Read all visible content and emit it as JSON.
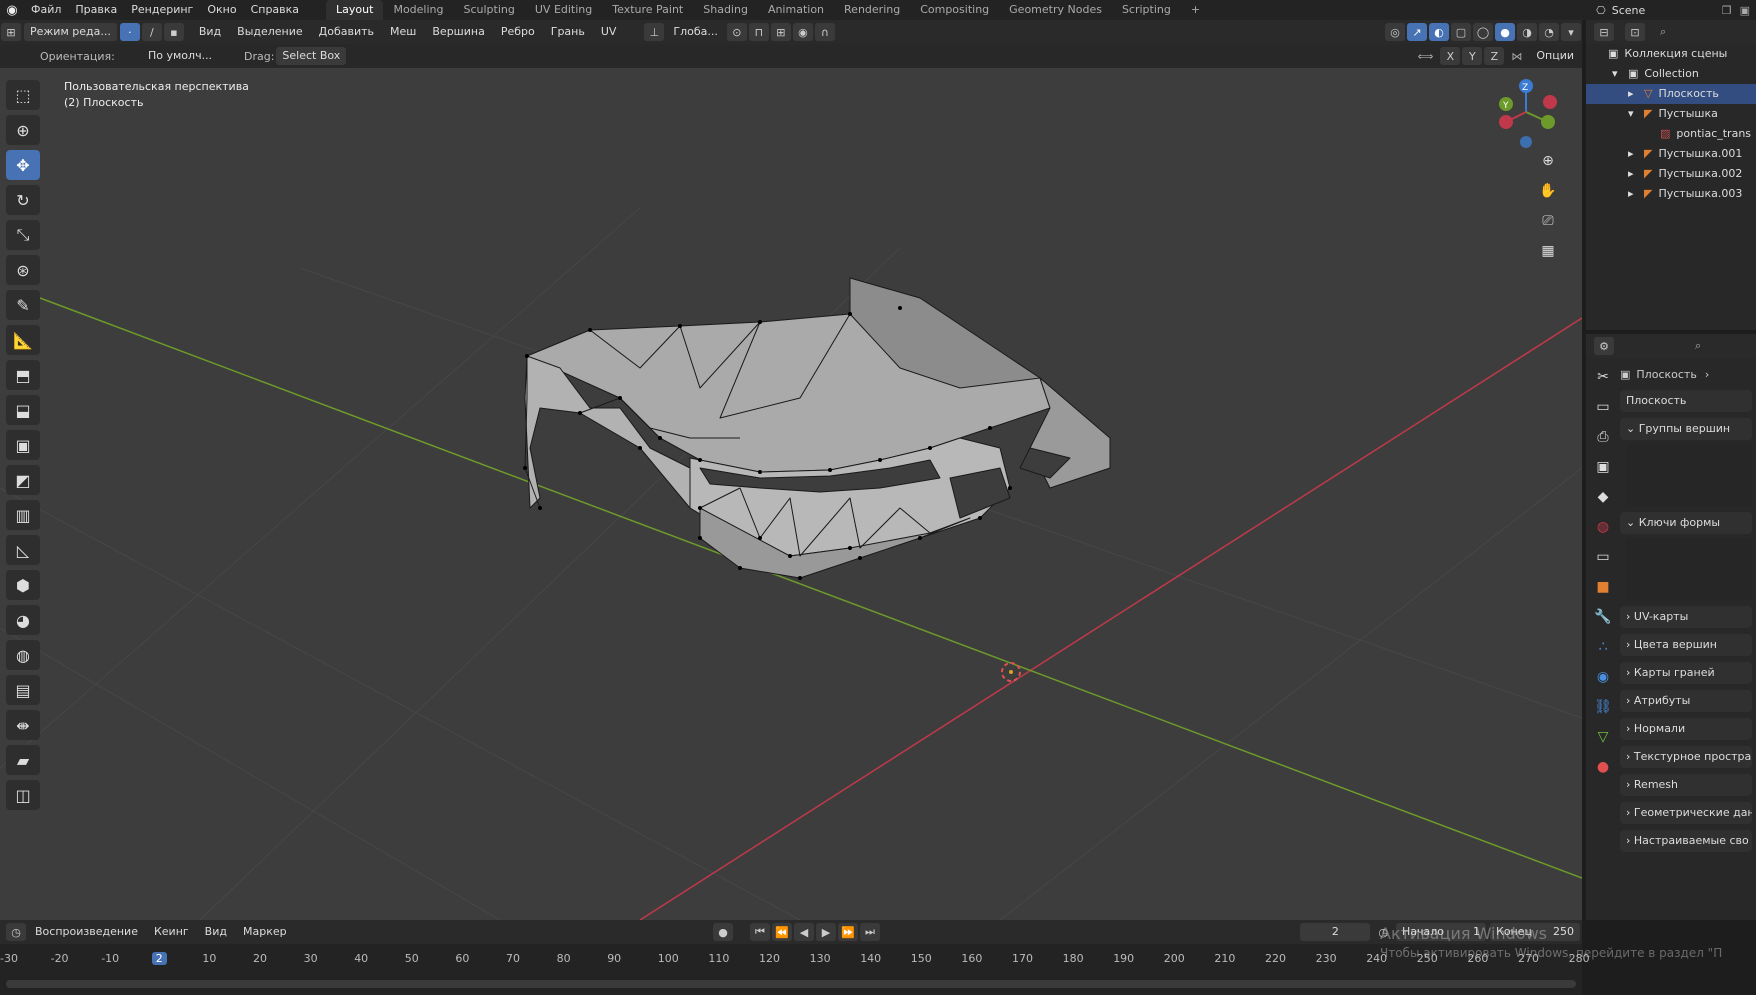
{
  "app_logo": "blender-icon",
  "menus": [
    "Файл",
    "Правка",
    "Рендеринг",
    "Окно",
    "Справка"
  ],
  "workspace_tabs": [
    "Layout",
    "Modeling",
    "Sculpting",
    "UV Editing",
    "Texture Paint",
    "Shading",
    "Animation",
    "Rendering",
    "Compositing",
    "Geometry Nodes",
    "Scripting",
    "+"
  ],
  "active_tab": "Layout",
  "scene_name": "Scene",
  "header3d": {
    "mode": "Режим реда...",
    "menus": [
      "Вид",
      "Выделение",
      "Добавить",
      "Меш",
      "Вершина",
      "Ребро",
      "Грань",
      "UV"
    ],
    "transform": "Глоба..."
  },
  "toolheader": {
    "orientation_label": "Ориентация:",
    "orientation_value": "По умолч...",
    "drag_label": "Drag:",
    "drag_value": "Select Box",
    "axes": [
      "X",
      "Y",
      "Z"
    ],
    "options": "Опции"
  },
  "viewport": {
    "view_name": "Пользовательская перспектива",
    "object_info": "(2) Плоскость"
  },
  "outliner": {
    "root": "Коллекция сцены",
    "items": [
      {
        "label": "Collection",
        "depth": 1,
        "type": "collection"
      },
      {
        "label": "Плоскость",
        "depth": 2,
        "type": "mesh",
        "selected": true
      },
      {
        "label": "Пустышка",
        "depth": 2,
        "type": "empty"
      },
      {
        "label": "pontiac_trans",
        "depth": 3,
        "type": "image"
      },
      {
        "label": "Пустышка.001",
        "depth": 2,
        "type": "empty"
      },
      {
        "label": "Пустышка.002",
        "depth": 2,
        "type": "empty"
      },
      {
        "label": "Пустышка.003",
        "depth": 2,
        "type": "empty"
      }
    ]
  },
  "properties": {
    "breadcrumb": "Плоскость",
    "mesh_name": "Плоскость",
    "panels_open": [
      "Группы вершин",
      "Ключи формы"
    ],
    "panels_closed": [
      "UV-карты",
      "Цвета вершин",
      "Карты граней",
      "Атрибуты",
      "Нормали",
      "Текстурное простран",
      "Remesh",
      "Геометрические дан",
      "Настраиваемые сво"
    ]
  },
  "timeline": {
    "menus": [
      "Воспроизведение",
      "Кеинг",
      "Вид",
      "Маркер"
    ],
    "current_frame": "2",
    "start_label": "Начало",
    "start": "1",
    "end_label": "Конец",
    "end": "250",
    "ticks": [
      "-30",
      "-20",
      "-10",
      "2",
      "10",
      "20",
      "30",
      "40",
      "50",
      "60",
      "70",
      "80",
      "90",
      "100",
      "110",
      "120",
      "130",
      "140",
      "150",
      "160",
      "170",
      "180",
      "190",
      "200",
      "210",
      "220",
      "230",
      "240",
      "250",
      "260",
      "270",
      "280"
    ]
  },
  "watermark": {
    "title": "Активация Windows",
    "text": "Чтобы активировать Windows, перейдите в раздел \"П"
  },
  "colors": {
    "accent": "#4772b3",
    "x_axis": "#c0394a",
    "y_axis": "#6d9a2a",
    "z_axis": "#3b7bd4",
    "mesh": "#a8a8a8",
    "background": "#3d3d3d"
  }
}
